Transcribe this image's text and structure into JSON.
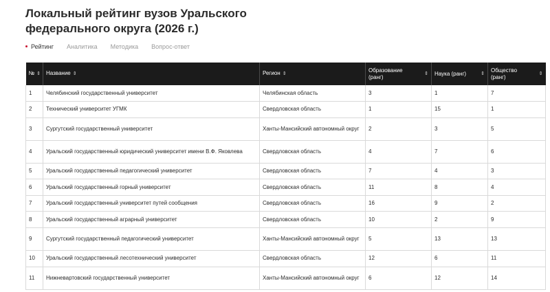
{
  "page": {
    "title": "Локальный рейтинг вузов Уральского федерального округа (2026 г.)"
  },
  "tabs": [
    {
      "label": "Рейтинг",
      "active": true
    },
    {
      "label": "Аналитика",
      "active": false
    },
    {
      "label": "Методика",
      "active": false
    },
    {
      "label": "Вопрос-ответ",
      "active": false
    }
  ],
  "table": {
    "columns": [
      "№",
      "Название",
      "Регион",
      "Образование (ранг)",
      "Наука (ранг)",
      "Общество (ранг)"
    ],
    "rows": [
      [
        "1",
        "Челябинский государственный университет",
        "Челябинская область",
        "3",
        "1",
        "7"
      ],
      [
        "2",
        "Технический университет УГМК",
        "Свердловская область",
        "1",
        "15",
        "1"
      ],
      [
        "3",
        "Сургутский государственный университет",
        "Ханты-Мансийский автономный округ",
        "2",
        "3",
        "5"
      ],
      [
        "4",
        "Уральский государственный юридический университет имени В.Ф. Яковлева",
        "Свердловская область",
        "4",
        "7",
        "6"
      ],
      [
        "5",
        "Уральский государственный педагогический университет",
        "Свердловская область",
        "7",
        "4",
        "3"
      ],
      [
        "6",
        "Уральский государственный горный университет",
        "Свердловская область",
        "11",
        "8",
        "4"
      ],
      [
        "7",
        "Уральский государственный университет путей сообщения",
        "Свердловская область",
        "16",
        "9",
        "2"
      ],
      [
        "8",
        "Уральский государственный аграрный университет",
        "Свердловская область",
        "10",
        "2",
        "9"
      ],
      [
        "9",
        "Сургутский государственный педагогический университет",
        "Ханты-Мансийский автономный округ",
        "5",
        "13",
        "13"
      ],
      [
        "10",
        "Уральский государственный лесотехнический университет",
        "Свердловская область",
        "12",
        "6",
        "11"
      ],
      [
        "11",
        "Нижневартовский государственный университет",
        "Ханты-Мансийский автономный округ",
        "6",
        "12",
        "14"
      ]
    ]
  },
  "colors": {
    "header_bg": "#1b1b1b",
    "accent": "#c8102e"
  }
}
